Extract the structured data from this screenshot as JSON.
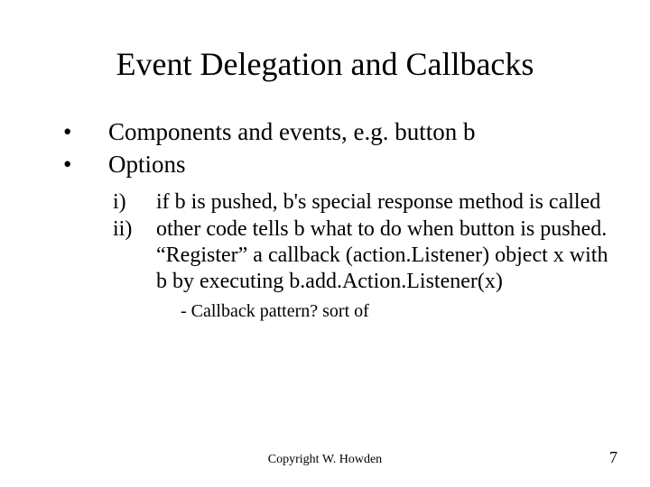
{
  "title": "Event Delegation and Callbacks",
  "bullets": [
    {
      "mark": "•",
      "text": "Components and events, e.g. button b"
    },
    {
      "mark": "•",
      "text": "Options"
    }
  ],
  "sublist": [
    {
      "mark": "i)",
      "text": "if b is pushed, b's special response method is called"
    },
    {
      "mark": "ii)",
      "text": "other code tells b what to do when button is pushed.  “Register” a callback (action.Listener) object x with b by executing b.add.Action.Listener(x)"
    }
  ],
  "subnote": "- Callback pattern? sort of",
  "footer": "Copyright W. Howden",
  "page": "7"
}
